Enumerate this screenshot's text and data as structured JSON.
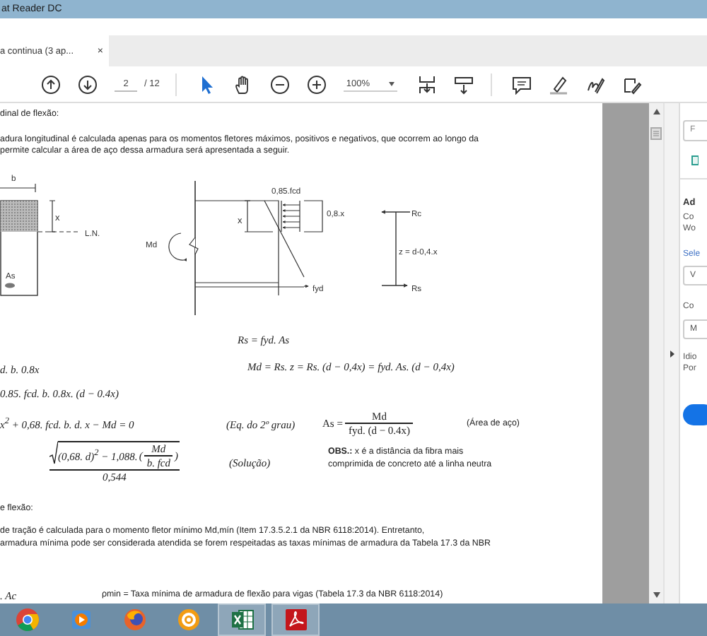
{
  "window": {
    "title": "at Reader DC"
  },
  "document_tab": {
    "label": "a continua (3 ap...",
    "close": "×"
  },
  "toolbar": {
    "page_field": "2",
    "page_total": "/ 12",
    "zoom": "100%",
    "tools": [
      {
        "kind": "pointer",
        "selected": true
      },
      {
        "kind": "hand",
        "selected": false
      }
    ]
  },
  "document": {
    "heading": "dinal de flexão:",
    "intro": [
      "adura longitudinal é calculada apenas para os momentos fletores máximos, positivos e negativos, que ocorrem ao longo da",
      "permite calcular a área de aço dessa armadura será apresentada a seguir."
    ],
    "diagram_labels": [
      "b",
      "x",
      "L.N.",
      "As",
      "Md",
      "x",
      "0,85.fcd",
      "0,8.x",
      "fyd",
      "Rc",
      "z = d-0,4.x",
      "Rs"
    ],
    "eq_rs": "Rs = fyd. As",
    "eq_rc": "d. b. 0.8x",
    "eq_md": "Md = Rs. z = Rs. (d − 0,4x) = fyd. As. (d − 0,4x)",
    "eq_md2": "0.85. fcd. b. 0.8x. (d − 0.4x)",
    "eq_quad": "x$^{2}$ + 0,68. fcd. b. d. x − Md = 0",
    "eq_quad_note": "(Eq. do 2º grau)",
    "as_formula": {
      "lhs": "As =",
      "numerator": "Md",
      "denominator": "fyd. (d − 0.4x)",
      "note": "(Área de aço)"
    },
    "solution": {
      "radicand": "(0,68. d)$^{2}$ − 1,088.",
      "paren_open": "(",
      "inner_numerator": "Md",
      "inner_denominator": "b. fcd",
      "paren_close": ")",
      "denominator": "0,544",
      "note": "(Solução)"
    },
    "obs": "**OBS.:** x é a distância da fibra mais comprimida de concreto até a linha neutra",
    "section2_heading": "e flexão:",
    "section2_text": [
      "de tração é calculada para o momento fletor mínimo Md,mín (Item 17.3.5.2.1 da NBR 6118:2014). Entretanto,",
      "armadura mínima pode ser considerada atendida se forem respeitadas as taxas mínimas de armadura da Tabela 17.3 da NBR"
    ],
    "eq_asmin": ". Ac",
    "rho_note": "ρmin = Taxa mínima de armadura de flexão para vigas (Tabela 17.3 da NBR 6118:2014)"
  },
  "right_panel": {
    "search_placeholder": "F",
    "heading": "Ad",
    "description": [
      "Co",
      "Wo"
    ],
    "select_label": "Sele",
    "select_1": "V",
    "label_2": "Co",
    "select_2": "M",
    "language_label": "Idio",
    "language_value": "Por"
  },
  "taskbar": [
    {
      "kind": "chrome",
      "running": false
    },
    {
      "kind": "media",
      "running": false
    },
    {
      "kind": "firefox",
      "running": false
    },
    {
      "kind": "gear",
      "running": false
    },
    {
      "kind": "excel",
      "running": true
    },
    {
      "kind": "acrobat",
      "running": true
    }
  ]
}
